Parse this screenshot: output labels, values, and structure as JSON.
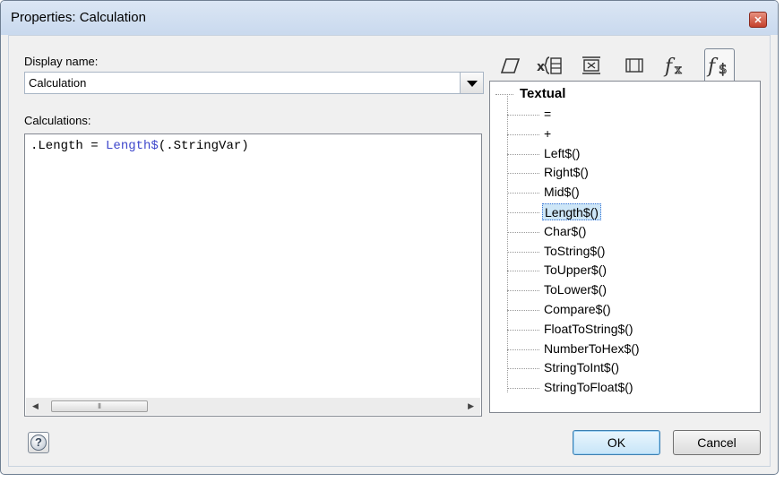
{
  "window": {
    "title": "Properties: Calculation",
    "close_icon": "close-icon"
  },
  "display_name": {
    "label": "Display name:",
    "value": "Calculation"
  },
  "calculations": {
    "label": "Calculations:",
    "code_prefix": ".Length = ",
    "code_function": "Length$",
    "code_args": "(.StringVar)",
    "function_color": "#3f48cc"
  },
  "toolbox_tabs": [
    {
      "name": "input-output-icon",
      "glyph": "▱"
    },
    {
      "name": "variable-icon",
      "glyph": "x{}"
    },
    {
      "name": "condition-icon",
      "glyph": "⊠"
    },
    {
      "name": "procedure-icon",
      "glyph": "▭"
    },
    {
      "name": "math-function-icon",
      "glyph": "𝑓x"
    },
    {
      "name": "string-function-icon",
      "glyph": "𝑓$",
      "active": true
    }
  ],
  "tree": {
    "root": "Textual",
    "items": [
      " =",
      " +",
      "Left$()",
      "Right$()",
      "Mid$()",
      "Length$()",
      "Char$()",
      "ToString$()",
      "ToUpper$()",
      "ToLower$()",
      "Compare$()",
      "FloatToString$()",
      "NumberToHex$()",
      "StringToInt$()",
      "StringToFloat$()"
    ],
    "selected": "Length$()"
  },
  "buttons": {
    "ok": "OK",
    "cancel": "Cancel",
    "help": "?"
  }
}
